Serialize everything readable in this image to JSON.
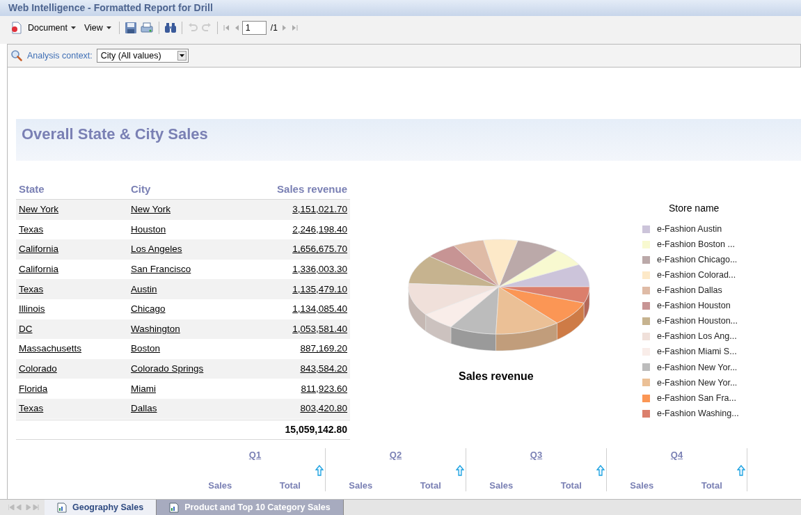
{
  "window": {
    "title": "Web Intelligence - Formatted Report for Drill"
  },
  "toolbar": {
    "menus": [
      {
        "label": "Document"
      },
      {
        "label": "View"
      }
    ],
    "page_input": "1",
    "page_total": "/1"
  },
  "analysis_context": {
    "label": "Analysis context:",
    "value": "City (All values)"
  },
  "report": {
    "title": "Overall State & City Sales",
    "table": {
      "columns": [
        "State",
        "City",
        "Sales revenue"
      ],
      "rows": [
        {
          "state": "New York",
          "city": "New York",
          "revenue": "3,151,021.70"
        },
        {
          "state": "Texas",
          "city": "Houston",
          "revenue": "2,246,198.40"
        },
        {
          "state": "California",
          "city": "Los Angeles",
          "revenue": "1,656,675.70"
        },
        {
          "state": "California",
          "city": "San Francisco",
          "revenue": "1,336,003.30"
        },
        {
          "state": "Texas",
          "city": "Austin",
          "revenue": "1,135,479.10"
        },
        {
          "state": "Illinois",
          "city": "Chicago",
          "revenue": "1,134,085.40"
        },
        {
          "state": "DC",
          "city": "Washington",
          "revenue": "1,053,581.40"
        },
        {
          "state": "Massachusetts",
          "city": "Boston",
          "revenue": "887,169.20"
        },
        {
          "state": "Colorado",
          "city": "Colorado Springs",
          "revenue": "843,584.20"
        },
        {
          "state": "Florida",
          "city": "Miami",
          "revenue": "811,923.60"
        },
        {
          "state": "Texas",
          "city": "Dallas",
          "revenue": "803,420.80"
        }
      ],
      "total": "15,059,142.80"
    },
    "chart": {
      "title": "Sales revenue",
      "legend_title": "Store name",
      "legend": [
        {
          "label": "e-Fashion Austin",
          "color": "#ccc4da"
        },
        {
          "label": "e-Fashion Boston ...",
          "color": "#f8f9d0"
        },
        {
          "label": "e-Fashion Chicago...",
          "color": "#bba9a9"
        },
        {
          "label": "e-Fashion Colorad...",
          "color": "#fde9c8"
        },
        {
          "label": "e-Fashion Dallas",
          "color": "#dfbba6"
        },
        {
          "label": "e-Fashion Houston",
          "color": "#c79494"
        },
        {
          "label": "e-Fashion Houston...",
          "color": "#c6b38f"
        },
        {
          "label": "e-Fashion Los Ang...",
          "color": "#f0e0da"
        },
        {
          "label": "e-Fashion Miami S...",
          "color": "#f9ede9"
        },
        {
          "label": "e-Fashion New Yor...",
          "color": "#bcbcbc"
        },
        {
          "label": "e-Fashion New Yor...",
          "color": "#ebc096"
        },
        {
          "label": "e-Fashion San Fra...",
          "color": "#fb9655"
        },
        {
          "label": "e-Fashion Washing...",
          "color": "#db7f6c"
        }
      ]
    },
    "quarters": [
      {
        "label": "Q1",
        "columns": [
          "Sales",
          "Total"
        ]
      },
      {
        "label": "Q2",
        "columns": [
          "Sales",
          "Total"
        ]
      },
      {
        "label": "Q3",
        "columns": [
          "Sales",
          "Total"
        ]
      },
      {
        "label": "Q4",
        "columns": [
          "Sales",
          "Total"
        ]
      }
    ]
  },
  "report_tabs": [
    {
      "label": "Geography Sales",
      "selected": true
    },
    {
      "label": "Product and Top 10 Category Sales",
      "selected": false
    }
  ]
}
